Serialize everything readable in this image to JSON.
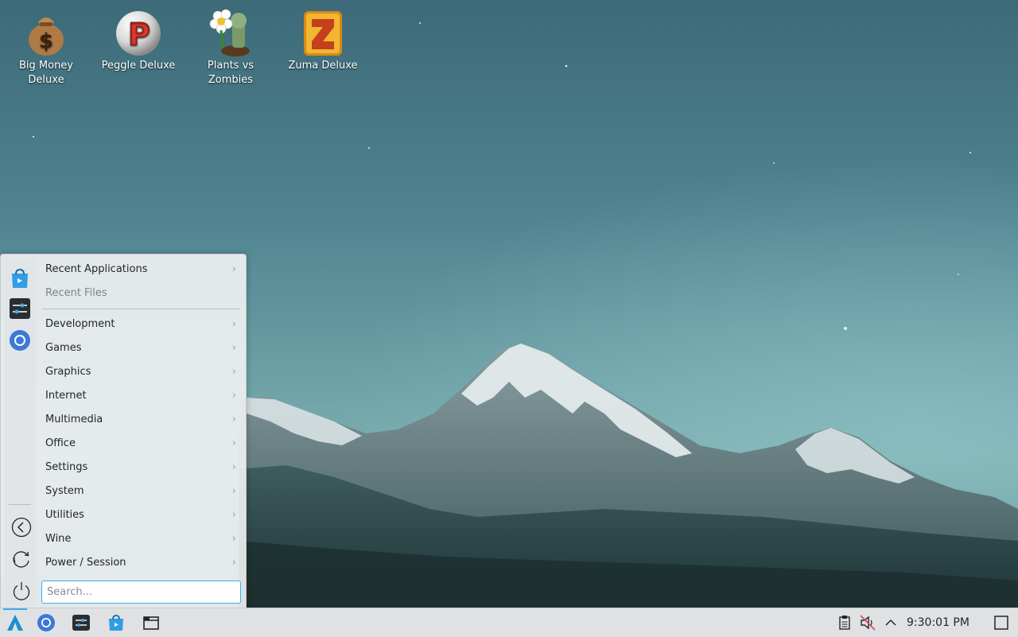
{
  "desktop": {
    "icons": [
      {
        "label": "Big Money Deluxe",
        "icon": "money-bag-icon"
      },
      {
        "label": "Peggle Deluxe",
        "icon": "peggle-ball-icon"
      },
      {
        "label": "Plants vs Zombies",
        "icon": "plants-vs-zombies-icon"
      },
      {
        "label": "Zuma Deluxe",
        "icon": "zuma-icon"
      }
    ]
  },
  "menu": {
    "favorites": [
      {
        "icon": "discover-store-icon"
      },
      {
        "icon": "system-settings-icon"
      },
      {
        "icon": "chromium-icon"
      }
    ],
    "actions": [
      {
        "icon": "back-icon"
      },
      {
        "icon": "restart-icon"
      },
      {
        "icon": "power-icon"
      }
    ],
    "recent_apps": "Recent Applications",
    "recent_files": "Recent Files",
    "categories": [
      "Development",
      "Games",
      "Graphics",
      "Internet",
      "Multimedia",
      "Office",
      "Settings",
      "System",
      "Utilities",
      "Wine",
      "Power / Session"
    ],
    "chevron": "›",
    "search_placeholder": "Search..."
  },
  "taskbar": {
    "launcher_icon": "app-launcher-icon",
    "tasks": [
      "chromium-icon",
      "system-settings-icon",
      "discover-store-icon",
      "file-manager-icon"
    ],
    "tray": [
      "clipboard-icon",
      "volume-muted-icon",
      "chevron-up-icon"
    ],
    "clock": "9:30:01 PM",
    "show_desktop_icon": "show-desktop-icon"
  },
  "colors": {
    "accent": "#3daee9",
    "menu_bg": "#eff0f1",
    "text": "#232629"
  }
}
